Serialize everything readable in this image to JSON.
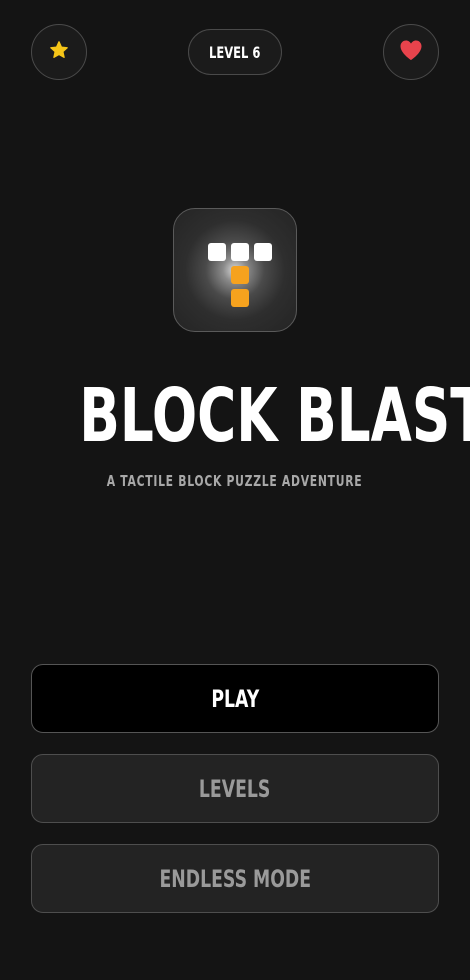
{
  "header": {
    "level_label": "LEVEL 6",
    "left_icon": "star-icon",
    "right_icon": "heart-icon",
    "star_color": "#f5c518",
    "heart_color": "#e8434c"
  },
  "logo": {
    "icon": "t-block-icon",
    "block_colors": [
      "#ffffff",
      "#f6a21e"
    ]
  },
  "title": "BLOCK BLAST",
  "subtitle": "A TACTILE BLOCK PUZZLE ADVENTURE",
  "menu": {
    "play": "PLAY",
    "levels": "LEVELS",
    "endless": "ENDLESS MODE"
  }
}
